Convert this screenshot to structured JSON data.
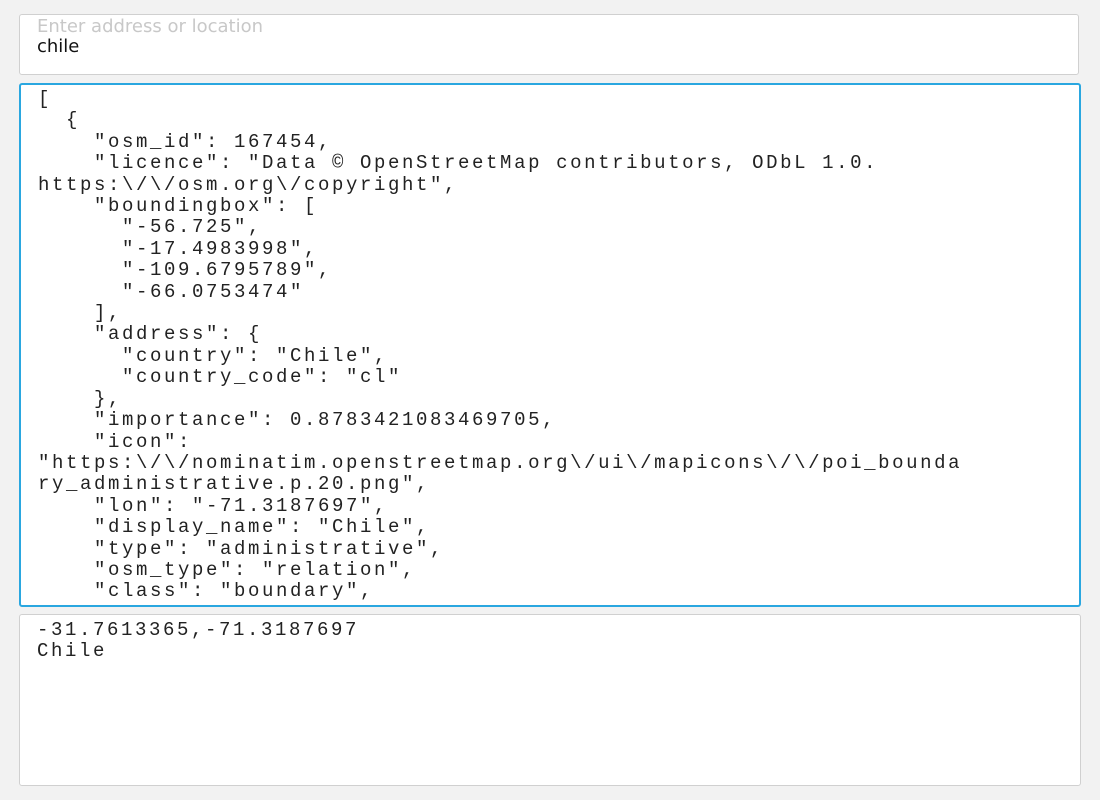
{
  "search": {
    "placeholder": "Enter address or location",
    "value": "chile"
  },
  "json_output": "[\n  {\n    \"osm_id\": 167454,\n    \"licence\": \"Data © OpenStreetMap contributors, ODbL 1.0.\nhttps:\\/\\/osm.org\\/copyright\",\n    \"boundingbox\": [\n      \"-56.725\",\n      \"-17.4983998\",\n      \"-109.6795789\",\n      \"-66.0753474\"\n    ],\n    \"address\": {\n      \"country\": \"Chile\",\n      \"country_code\": \"cl\"\n    },\n    \"importance\": 0.8783421083469705,\n    \"icon\":\n\"https:\\/\\/nominatim.openstreetmap.org\\/ui\\/mapicons\\/\\/poi_bounda\nry_administrative.p.20.png\",\n    \"lon\": \"-71.3187697\",\n    \"display_name\": \"Chile\",\n    \"type\": \"administrative\",\n    \"osm_type\": \"relation\",\n    \"class\": \"boundary\",",
  "result": "-31.7613365,-71.3187697\nChile"
}
